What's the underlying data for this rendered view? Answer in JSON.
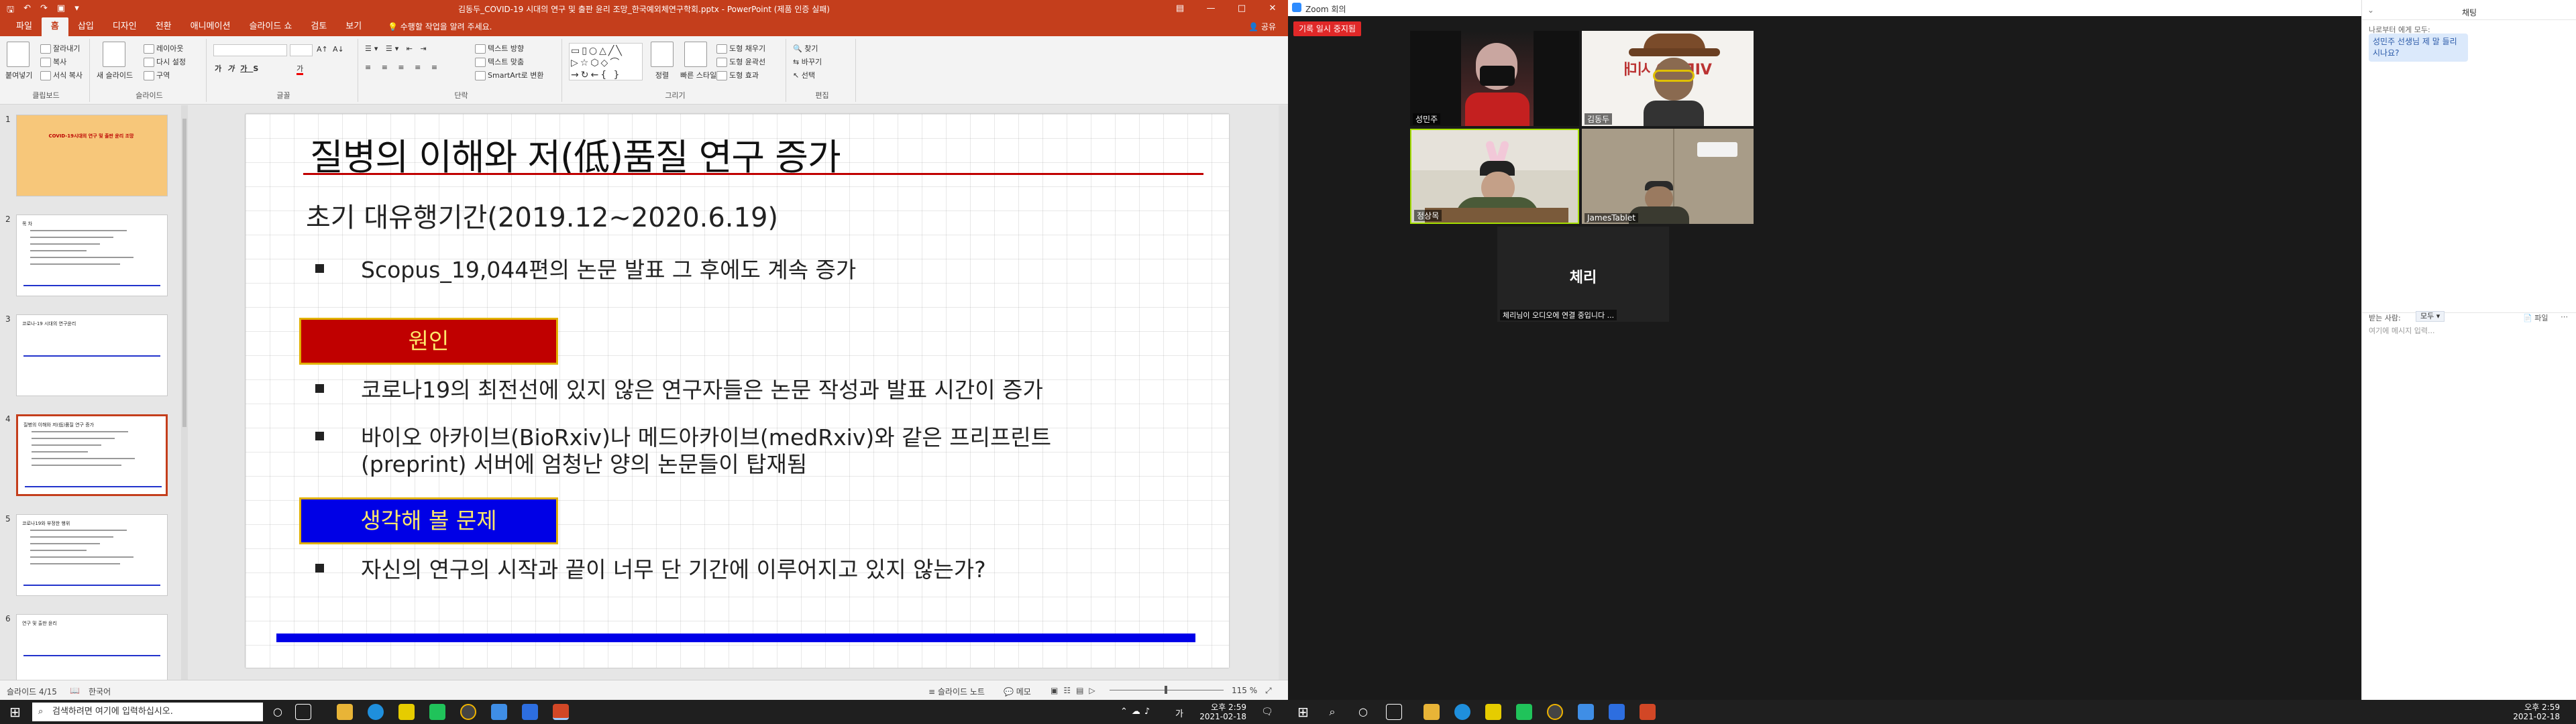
{
  "ppt": {
    "titlebar": {
      "title": "김동두_COVID-19 시대의 연구 및 출판 윤리 조망_한국예외체연구학회.pptx - PowerPoint (제품 인증 실패)"
    },
    "tabs": [
      "파일",
      "홈",
      "삽입",
      "디자인",
      "전환",
      "애니메이션",
      "슬라이드 쇼",
      "검토",
      "보기"
    ],
    "active_tab": "홈",
    "tell_me": "수행할 작업을 알려 주세요.",
    "share": "공유",
    "ribbon": {
      "clipboard": {
        "paste": "붙여넣기",
        "cut": "잘라내기",
        "copy": "복사",
        "format_painter": "서식 복사",
        "label": "클립보드"
      },
      "slides": {
        "new_slide": "새 슬라이드",
        "layout": "레이아웃",
        "reset": "다시 설정",
        "section": "구역",
        "label": "슬라이드"
      },
      "font": {
        "label": "글꼴"
      },
      "paragraph": {
        "text_direction": "텍스트 방향",
        "align_text": "텍스트 맞춤",
        "smartart": "SmartArt로 변환",
        "label": "단락"
      },
      "drawing": {
        "arrange": "정렬",
        "quick_styles": "빠른 스타일",
        "shape_fill": "도형 채우기",
        "shape_outline": "도형 윤곽선",
        "shape_effects": "도형 효과",
        "label": "그리기"
      },
      "editing": {
        "find": "찾기",
        "replace": "바꾸기",
        "select": "선택",
        "label": "편집"
      }
    },
    "thumbnails": [
      {
        "num": "1",
        "title": "COVID-19시대의 연구 및 출판 윤리 조망"
      },
      {
        "num": "2",
        "title": "목 차"
      },
      {
        "num": "3",
        "title": "코로나-19 시대의 연구윤리"
      },
      {
        "num": "4",
        "title": "질병의 이해와 저(低)품질 연구 증가"
      },
      {
        "num": "5",
        "title": "코로나19와 부정한 행위"
      },
      {
        "num": "6",
        "title": "연구 및 출판 윤리"
      }
    ],
    "slide": {
      "title": "질병의 이해와 저(低)품질 연구 증가",
      "subtitle": "초기 대유행기간(2019.12~2020.6.19)",
      "bullet1": "Scopus_19,044편의 논문 발표 그 후에도 계속 증가",
      "box1": "원인",
      "bullet2": "코로나19의 최전선에 있지 않은 연구자들은 논문 작성과 발표 시간이 증가",
      "bullet3_line1": "바이오 아카이브(BioRxiv)나 메드아카이브(medRxiv)와 같은 프리프린트",
      "bullet3_line2": "(preprint) 서버에 엄청난 양의 논문들이 탑재됨",
      "box2": "생각해 볼 문제",
      "bullet4": "자신의 연구의 시작과 끝이 너무 단 기간에 이루어지고 있지 않는가?"
    },
    "status": {
      "slide_count": "슬라이드 4/15",
      "language": "한국어",
      "notes": "슬라이드 노트",
      "comments": "메모",
      "zoom": "115 %"
    }
  },
  "taskbar_left": {
    "search_placeholder": "검색하려면 여기에 입력하십시오.",
    "time": "오후 2:59",
    "date": "2021-02-18",
    "lang": "가"
  },
  "taskbar_right": {
    "time": "오후 2:59",
    "date": "2021-02-18"
  },
  "zoom": {
    "window_title": "Zoom 회의",
    "rec_badge": "기록 일시 중지됨",
    "participants": [
      {
        "name": "성민주"
      },
      {
        "name": "김동두"
      },
      {
        "name": "정상목"
      },
      {
        "name": "JamesTablet"
      },
      {
        "name": "체리"
      }
    ],
    "audio_notice": "체리님이 오디오에 연결 중입니다 ...",
    "chat": {
      "title": "채팅",
      "sender": "나로부터 에게 모두:",
      "message": "성민주 선생님 제 말 들리시나요?",
      "to_label": "받는 사람:",
      "to_value": "모두",
      "file": "파일",
      "input_placeholder": "여기에 메시지 입력..."
    }
  }
}
